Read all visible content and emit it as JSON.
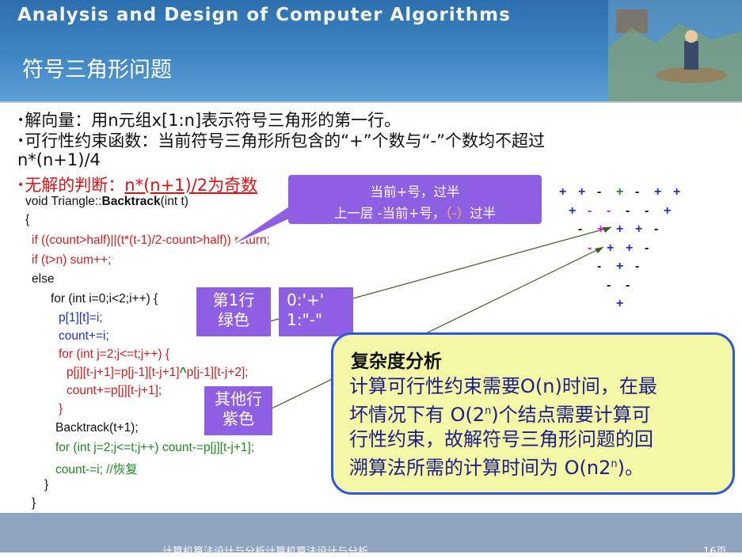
{
  "header": {
    "course_title": "Analysis and Design of Computer Algorithms",
    "slide_title": "符号三角形问题"
  },
  "bullets": [
    "解向量：用n元组x[1:n]表示符号三角形的第一行。",
    "可行性约束函数：当前符号三角形所包含的“+”个数与“-”个数均不超过",
    "n*(n+1)/4",
    "无解的判断：",
    "n*(n+1)/2为奇数"
  ],
  "code": [
    "void Triangle::",
    "Backtrack",
    "(int t)",
    "{",
    "if ((count>half)||(t*(t-1)/2-count>half)) return;",
    "if (t>n) sum++;",
    "else",
    "for (int i=0;i<2;i++) {",
    "p[1][t]=i;",
    "count+=i;",
    "for (int j=2;j<=t;j++) {",
    "p[j][t-j+1]=p[j-1][t-j+1]",
    "^",
    "p[j-1][t-j+2];",
    "count+=p[j][t-j+1];",
    "}",
    "Backtrack(t+1);",
    "for (int j=2;j<=t;j++)  count-=p[j][t-j+1];",
    "count-=i;   //恢复",
    "}",
    "}"
  ],
  "callout": {
    "line1": "当前+号，过半",
    "line2a": "上一层 -当前+号，",
    "line2b": "（-）",
    "line2c": "过半"
  },
  "labels": {
    "row1_a": "第1行",
    "row1_b": "绿色",
    "map_a": "0:'+'",
    "map_b": "1:\"-\"",
    "other_a": "其他行",
    "other_b": "紫色"
  },
  "complexity": {
    "title": "复杂度分析",
    "l1": "计算可行性约束需要O(n)时间，在最",
    "l2a": "坏情况下有 O(2",
    "sup1": "n",
    "l2b": ")个结点需要计算可",
    "l3": "行性约束，故解符号三角形问题的回",
    "l4a": "溯算法所需的计算时间为 O(n2",
    "sup2": "n",
    "l4b": ")。"
  },
  "triangle": [
    [
      "+",
      "+",
      "-",
      "+",
      "-",
      "+",
      "+"
    ],
    [
      "+",
      "-",
      "-",
      "-",
      "-",
      "+"
    ],
    [
      "-",
      "+",
      "+",
      "+",
      "-"
    ],
    [
      "-",
      "+",
      "+",
      "-"
    ],
    [
      "-",
      "+",
      "-"
    ],
    [
      "-",
      "-"
    ],
    [
      "+"
    ]
  ],
  "footer": {
    "text": "计算机算法设计与分析计算机算法设计与分析",
    "page": "16页"
  },
  "colors": {
    "header": "#3f86c3",
    "callout": "#8f5fe3",
    "complexity_bg": "#f3f7a6",
    "complexity_border": "#2b56e6",
    "first_row": "#1f8b1f",
    "other_rows": "#d81bd8",
    "sign": "#1d2ed6"
  }
}
